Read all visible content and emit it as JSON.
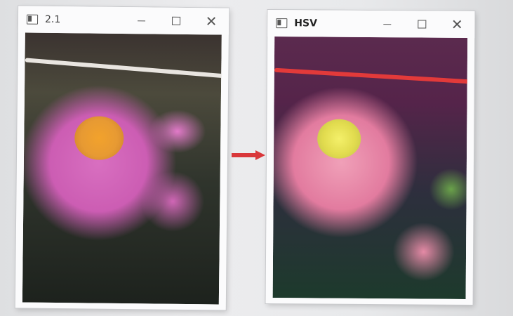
{
  "windows": [
    {
      "title": "2.1"
    },
    {
      "title": "HSV"
    }
  ],
  "controls": {
    "minimize": "minimize-icon",
    "maximize": "maximize-icon",
    "close": "close-icon"
  },
  "arrow": {
    "color": "#d9373a"
  }
}
